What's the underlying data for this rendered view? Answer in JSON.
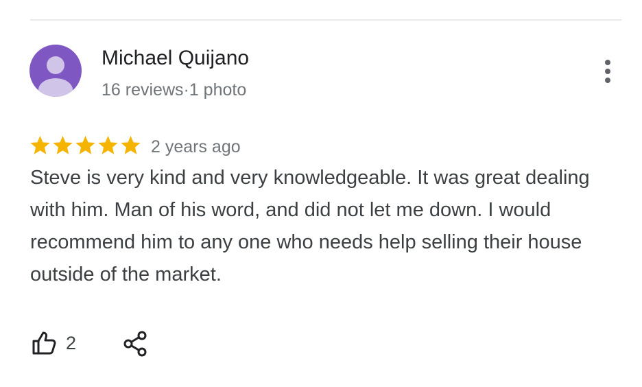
{
  "reviewer": {
    "name": "Michael Quijano",
    "meta": "16 reviews·1 photo",
    "avatar_icon": "person-avatar-icon",
    "avatar_color": "#7e57c2"
  },
  "review": {
    "rating": 5,
    "max_rating": 5,
    "star_color": "#f4b400",
    "date": "2 years ago",
    "text": "Steve is very kind and very knowledgeable. It was great dealing with him. Man of his word, and did not let me down. I would recommend him to any one who needs help selling their house outside of the market."
  },
  "actions": {
    "like_count": "2",
    "like_icon": "thumbs-up-icon",
    "share_icon": "share-icon",
    "more_icon": "more-vert-icon"
  }
}
